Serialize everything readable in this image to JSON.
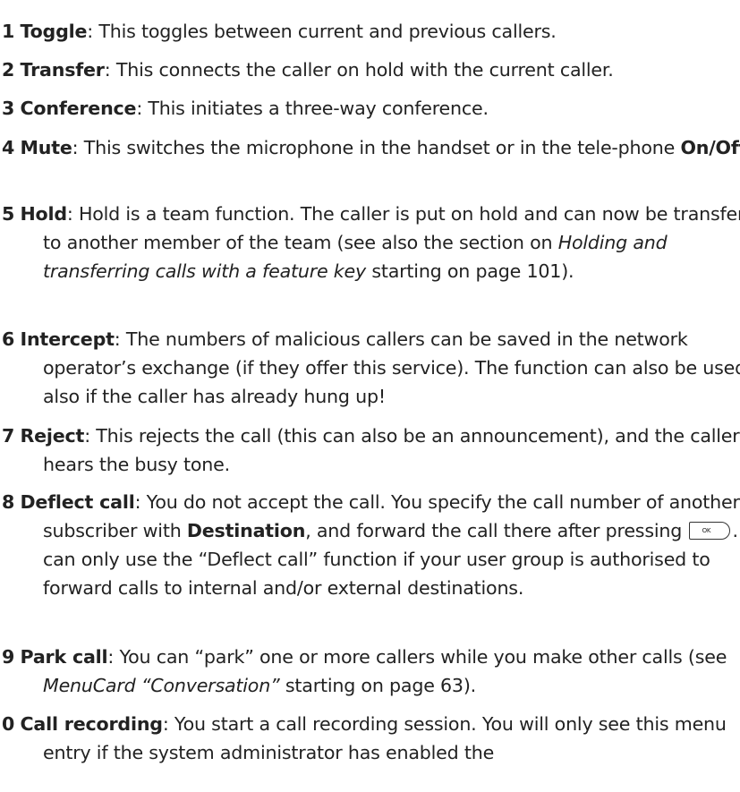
{
  "items": [
    {
      "num": "1",
      "name": "Toggle",
      "text": ": This toggles between current and previous callers."
    },
    {
      "num": "2",
      "name": "Transfer",
      "text": ": This connects the caller on hold with the current caller."
    },
    {
      "num": "3",
      "name": "Conference",
      "text": ": This initiates a three-way conference."
    },
    {
      "num": "4",
      "name": "Mute",
      "text": ": This switches the microphone in the handset or in the tele-phone ",
      "bold_after": "On/Off",
      "tail": "."
    },
    {
      "num": "5",
      "name": "Hold",
      "text": ": Hold is a team function. The caller is put on hold and can now be transferred to another member of the team (see also the section on ",
      "italic": "Holding and transferring calls with a feature key",
      "tail": " starting on page 101)."
    },
    {
      "num": "6",
      "name": "Intercept",
      "text": ": The numbers of malicious callers can be saved in the network operator’s exchange (if they offer this service). The function can also be used also if the caller has already hung up!"
    },
    {
      "num": "7",
      "name": "Reject",
      "text": ": This rejects the call (this can also be an announcement), and the caller hears the busy tone."
    },
    {
      "num": "8",
      "name": "Deflect call",
      "text": ": You do not accept the call. You specify the call number of another subscriber with ",
      "bold_after": "Destination",
      "mid": ", and forward the call there after pressing ",
      "key_label": "OK",
      "tail": ". You can only use the “Deflect call” function if your user group is authorised to forward calls to internal and/or external destinations."
    },
    {
      "num": "9",
      "name": "Park call",
      "text": ": You can “park” one or more callers while you make other calls (see ",
      "italic": "MenuCard “Conversation”",
      "tail": " starting on page 63)."
    },
    {
      "num": "0",
      "name": "Call recording",
      "text": ": You start a call recording session. You will only see this menu entry if the system administrator has enabled the"
    }
  ]
}
